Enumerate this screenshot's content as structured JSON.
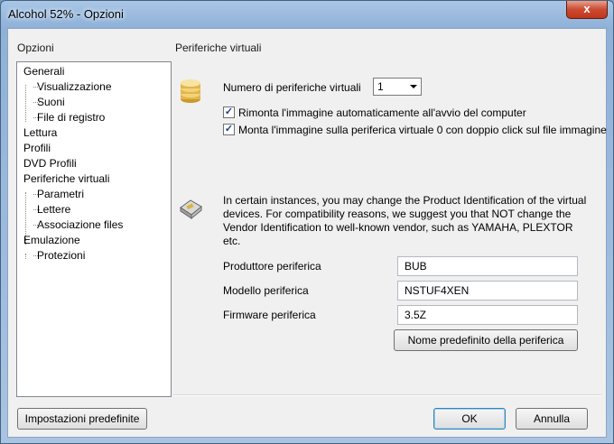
{
  "window": {
    "title": "Alcohol 52% - Opzioni",
    "close_label": "x"
  },
  "tree": {
    "heading": "Opzioni",
    "items": [
      {
        "label": "Generali",
        "level": 0
      },
      {
        "label": "Visualizzazione",
        "level": 1
      },
      {
        "label": "Suoni",
        "level": 1
      },
      {
        "label": "File di registro",
        "level": 1
      },
      {
        "label": "Lettura",
        "level": 0
      },
      {
        "label": "Profili",
        "level": 0
      },
      {
        "label": "DVD Profili",
        "level": 0
      },
      {
        "label": "Periferiche virtuali",
        "level": 0
      },
      {
        "label": "Parametri",
        "level": 1
      },
      {
        "label": "Lettere",
        "level": 1
      },
      {
        "label": "Associazione files",
        "level": 1
      },
      {
        "label": "Emulazione",
        "level": 0
      },
      {
        "label": "Protezioni",
        "level": 1
      }
    ]
  },
  "panel": {
    "heading": "Periferiche virtuali",
    "count_label": "Numero di periferiche virtuali",
    "count_value": "1",
    "remount_label": "Rimonta l'immagine automaticamente all'avvio del computer",
    "remount_checked": true,
    "mount_label": "Monta l'immagine sulla periferica virtuale 0 con doppio click sul file immagine",
    "mount_checked": true,
    "info_text": "In certain instances, you may change the Product Identification of the virtual devices. For compatibility reasons, we suggest you that NOT change the Vendor Identification to well-known vendor, such as YAMAHA, PLEXTOR etc.",
    "vendor_label": "Produttore periferica",
    "vendor_value": "BUB",
    "model_label": "Modello periferica",
    "model_value": "NSTUF4XEN",
    "firmware_label": "Firmware periferica",
    "firmware_value": "3.5Z",
    "default_name_button": "Nome predefinito della periferica"
  },
  "footer": {
    "defaults_button": "Impostazioni predefinite",
    "ok_button": "OK",
    "cancel_button": "Annulla"
  },
  "icons": {
    "drives": "drive-stack-icon",
    "info": "device-chip-icon"
  }
}
